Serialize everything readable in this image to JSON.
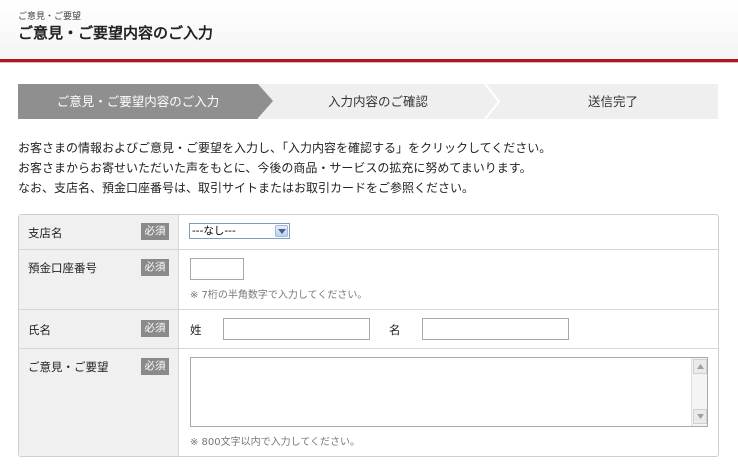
{
  "header": {
    "breadcrumb": "ご意見・ご要望",
    "title": "ご意見・ご要望内容のご入力",
    "accent_color": "#b0191f"
  },
  "steps": [
    {
      "label": "ご意見・ご要望内容のご入力",
      "active": true
    },
    {
      "label": "入力内容のご確認",
      "active": false
    },
    {
      "label": "送信完了",
      "active": false
    }
  ],
  "intro": [
    "お客さまの情報およびご意見・ご要望を入力し、「入力内容を確認する」をクリックしてください。",
    "お客さまからお寄せいただいた声をもとに、今後の商品・サービスの拡充に努めてまいります。",
    "なお、支店名、預金口座番号は、取引サイトまたはお取引カードをご参照ください。"
  ],
  "form": {
    "required_badge": "必須",
    "branch": {
      "label": "支店名",
      "selected": "---なし---",
      "arrow_icon": "chevron-down-icon"
    },
    "account": {
      "label": "預金口座番号",
      "value": "",
      "note": "※ 7桁の半角数字で入力してください。"
    },
    "name": {
      "label": "氏名",
      "last_label": "姓",
      "first_label": "名",
      "last_value": "",
      "first_value": ""
    },
    "opinion": {
      "label": "ご意見・ご要望",
      "value": "",
      "note": "※ 800文字以内で入力してください。"
    }
  }
}
